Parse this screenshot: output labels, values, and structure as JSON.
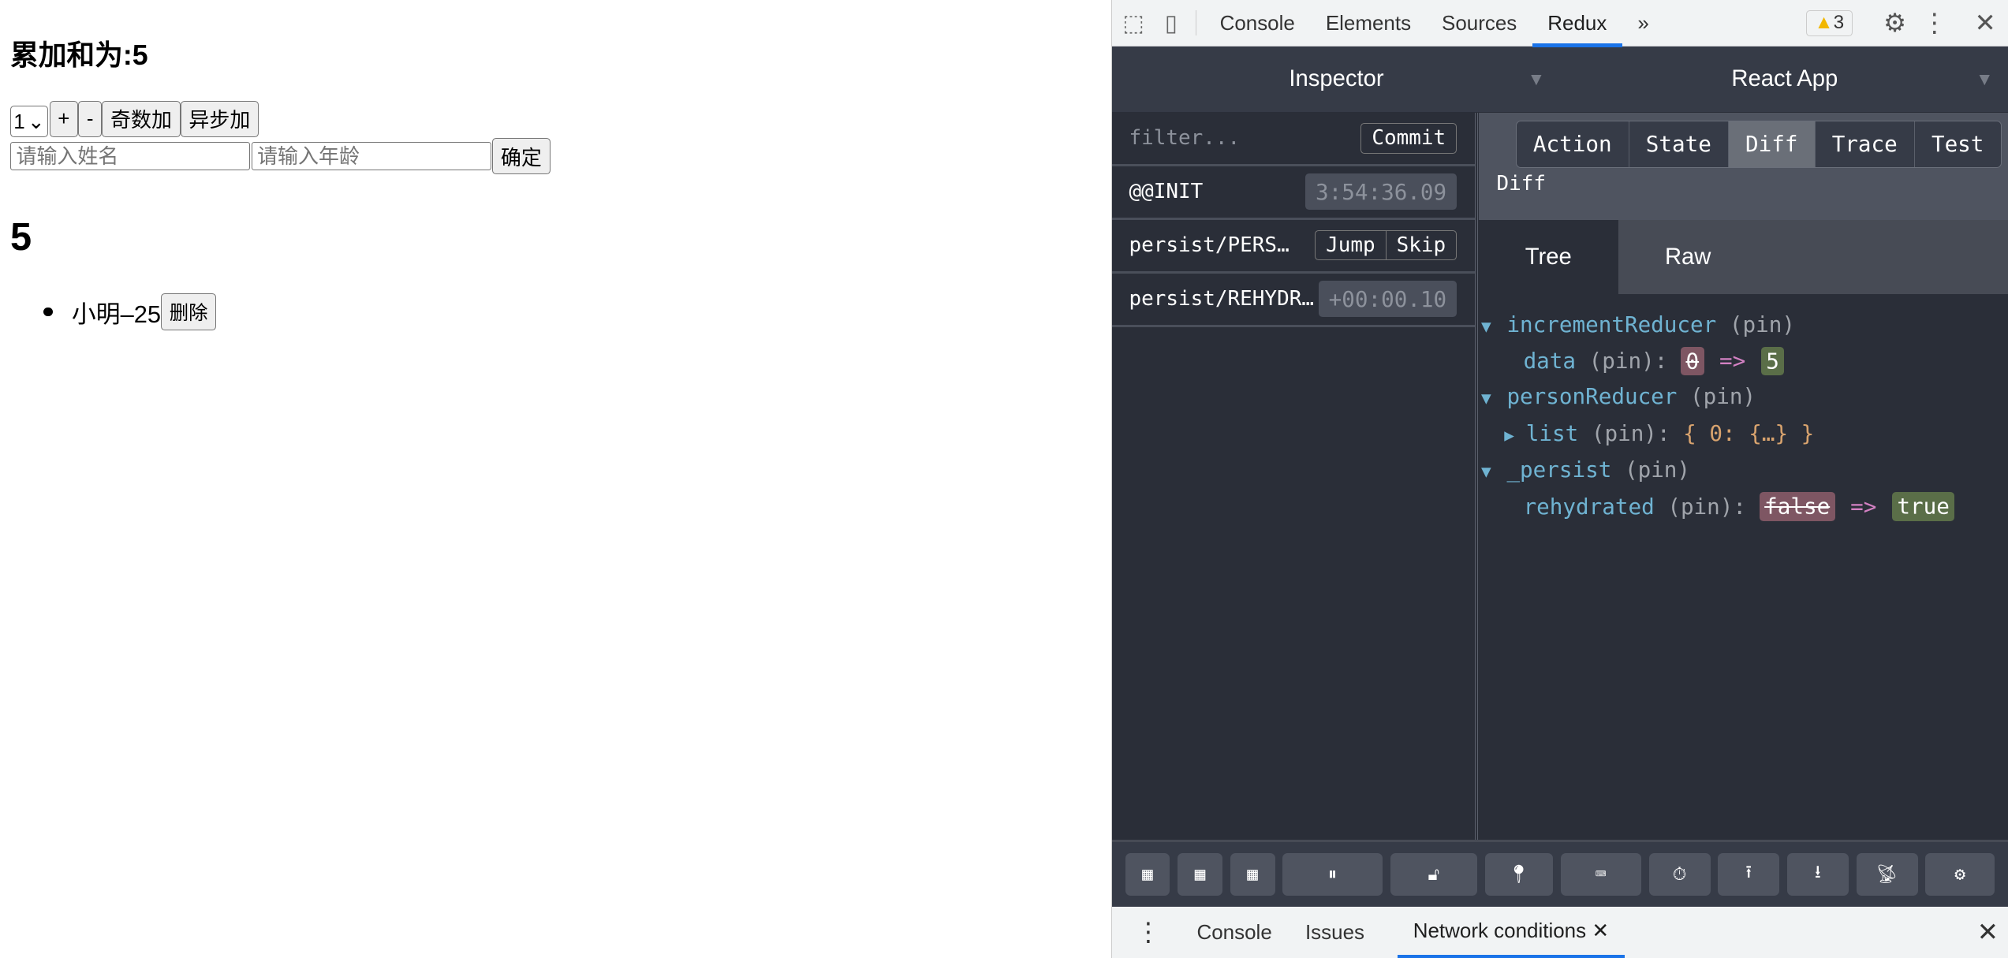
{
  "page": {
    "heading": "累加和为:5",
    "select_value": "1",
    "buttons": [
      "+",
      "-",
      "奇数加",
      "异步加"
    ],
    "name_placeholder": "请输入姓名",
    "age_placeholder": "请输入年龄",
    "confirm": "确定",
    "count": "5",
    "list": [
      {
        "text": "小明–25",
        "delete": "删除"
      }
    ]
  },
  "devtools": {
    "tabs": [
      "Console",
      "Elements",
      "Sources",
      "Redux"
    ],
    "active_tab": "Redux",
    "more": "»",
    "warnings": "3",
    "redux": {
      "monitor": "Inspector",
      "instance": "React App",
      "filter_placeholder": "filter...",
      "commit": "Commit",
      "actions": [
        {
          "name": "@@INIT",
          "time": "3:54:36.09"
        },
        {
          "name": "persist/PERS…",
          "jump": "Jump",
          "skip": "Skip"
        },
        {
          "name": "persist/REHYDR…",
          "time": "+00:00.10"
        }
      ],
      "inspector_tabs": [
        "Action",
        "State",
        "Diff",
        "Trace",
        "Test"
      ],
      "active_inspector_tab": "Diff",
      "diff_label": "Diff",
      "view_tabs": [
        "Tree",
        "Raw"
      ],
      "active_view": "Tree",
      "tree": {
        "pin": "(pin)",
        "r1": "incrementReducer",
        "r1k": "data",
        "r1old": "0",
        "r1new": "5",
        "r2": "personReducer",
        "r2k": "list",
        "r2v": "{ 0: {…} }",
        "r3": "_persist",
        "r3k": "rehydrated",
        "r3old": "false",
        "r3new": "true",
        "arrow": "=>"
      }
    },
    "drawer": {
      "tabs": [
        "Console",
        "Issues",
        "Network conditions"
      ],
      "active": "Network conditions"
    },
    "colors": {
      "accent": "#1a73e8",
      "key": "#6fb3d2",
      "removed": "#7e5663",
      "added": "#5a6e48"
    }
  }
}
